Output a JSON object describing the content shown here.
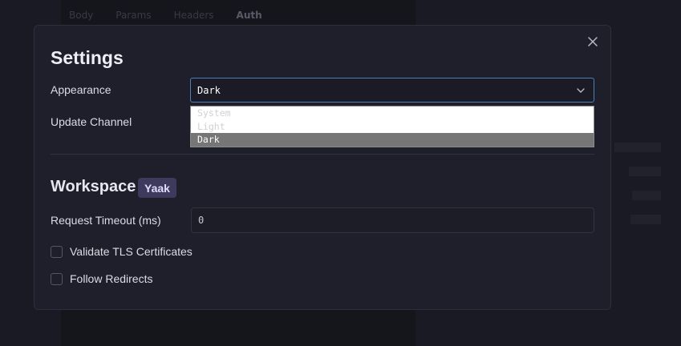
{
  "background": {
    "tabs": [
      "Body",
      "Params",
      "Headers",
      "Auth"
    ]
  },
  "dialog": {
    "title": "Settings",
    "appearance": {
      "label": "Appearance",
      "selected": "Dark",
      "options": [
        "System",
        "Light",
        "Dark"
      ]
    },
    "update_channel": {
      "label": "Update Channel"
    },
    "workspace": {
      "title": "Workspace",
      "badge": "Yaak",
      "request_timeout": {
        "label": "Request Timeout (ms)",
        "value": "0"
      },
      "validate_tls": {
        "label": "Validate TLS Certificates",
        "checked": false
      },
      "follow_redirects": {
        "label": "Follow Redirects",
        "checked": false
      }
    }
  },
  "colors": {
    "accent_border": "#4a7fb8",
    "badge_bg": "#3d3a5e",
    "dialog_bg": "#1f1f2b"
  }
}
